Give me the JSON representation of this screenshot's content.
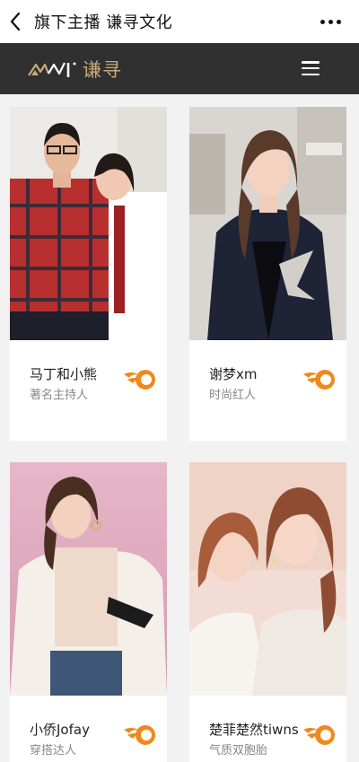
{
  "header": {
    "title": "旗下主播 谦寻文化",
    "back_icon": "back-chevron-icon",
    "more_icon": "more-dots-icon"
  },
  "brand": {
    "logo_text": "谦寻",
    "menu_icon": "hamburger-menu-icon",
    "accent_color": "#c8a97d",
    "bar_color": "#303030"
  },
  "streamers": [
    {
      "name": "马丁和小熊",
      "desc": "著名主持人"
    },
    {
      "name": "谢梦xm",
      "desc": "时尚红人"
    },
    {
      "name": "小侨Jofay",
      "desc": "穿搭达人"
    },
    {
      "name": "楚菲楚然tiwns",
      "desc": "气质双胞胎"
    }
  ],
  "flame_color": "#f0891c"
}
